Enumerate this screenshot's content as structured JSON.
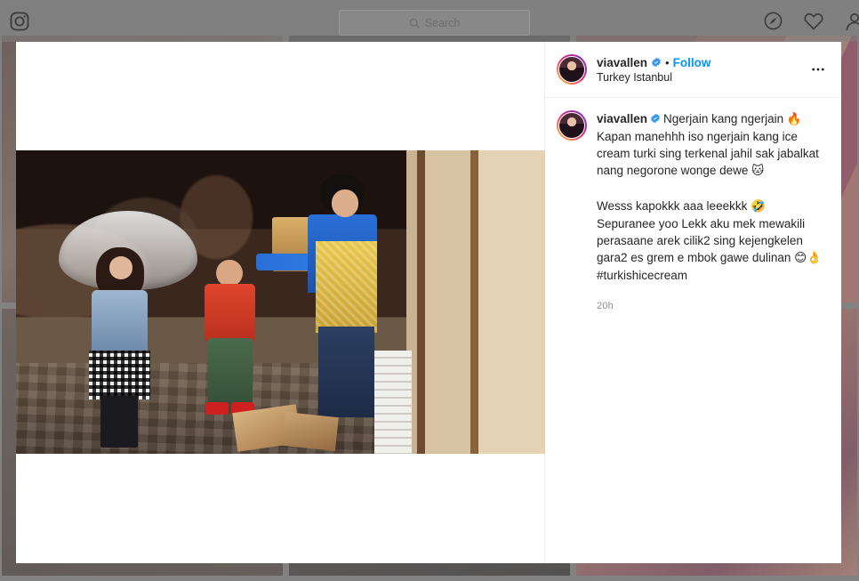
{
  "navbar": {
    "logo_icon": "instagram-camera-icon",
    "search": {
      "placeholder": "Search",
      "value": "",
      "icon": "search-icon"
    },
    "icons": [
      {
        "name": "explore-compass-icon",
        "label": "Explore"
      },
      {
        "name": "activity-heart-icon",
        "label": "Activity"
      },
      {
        "name": "profile-person-icon",
        "label": "Profile"
      }
    ]
  },
  "post": {
    "header": {
      "username": "viavallen",
      "verified_icon": "verified-badge-icon",
      "separator": "•",
      "follow_label": "Follow",
      "location": "Turkey Istanbul",
      "options_icon": "more-options-icon",
      "avatar_name": "viavallen"
    },
    "caption": {
      "username": "viavallen",
      "line1": "Ngerjain kang ngerjain",
      "emoji1": "🔥",
      "line2": "Kapan manehhh iso ngerjain kang ice cream turki sing terkenal jahil sak jabalkat nang negorone wonge dewe",
      "emoji2": "🐱",
      "line3": "Wesss kapokkk aaa leeekkk",
      "emoji3": "🤣",
      "line4": "Sepuranee yoo Lekk aku mek mewakili perasaane arek cilik2 sing kejengkelen gara2 es grem e mbok gawe dulinan",
      "emoji4": "😊",
      "emoji5": "👌",
      "hashtag": "#turkishicecream"
    },
    "timestamp": "20h",
    "media": {
      "alt": "Street scene: woman with transparent umbrella receiving a Turkish ice cream from a vendor in blue shirt and gold apron"
    }
  },
  "colors": {
    "accent_blue": "#0095f6",
    "verified_blue": "#3897f0",
    "text_primary": "#262626",
    "text_secondary": "#8e8e8e",
    "backdrop": "#8e8e8e",
    "modal_bg": "#ffffff",
    "divider": "#efefef"
  }
}
